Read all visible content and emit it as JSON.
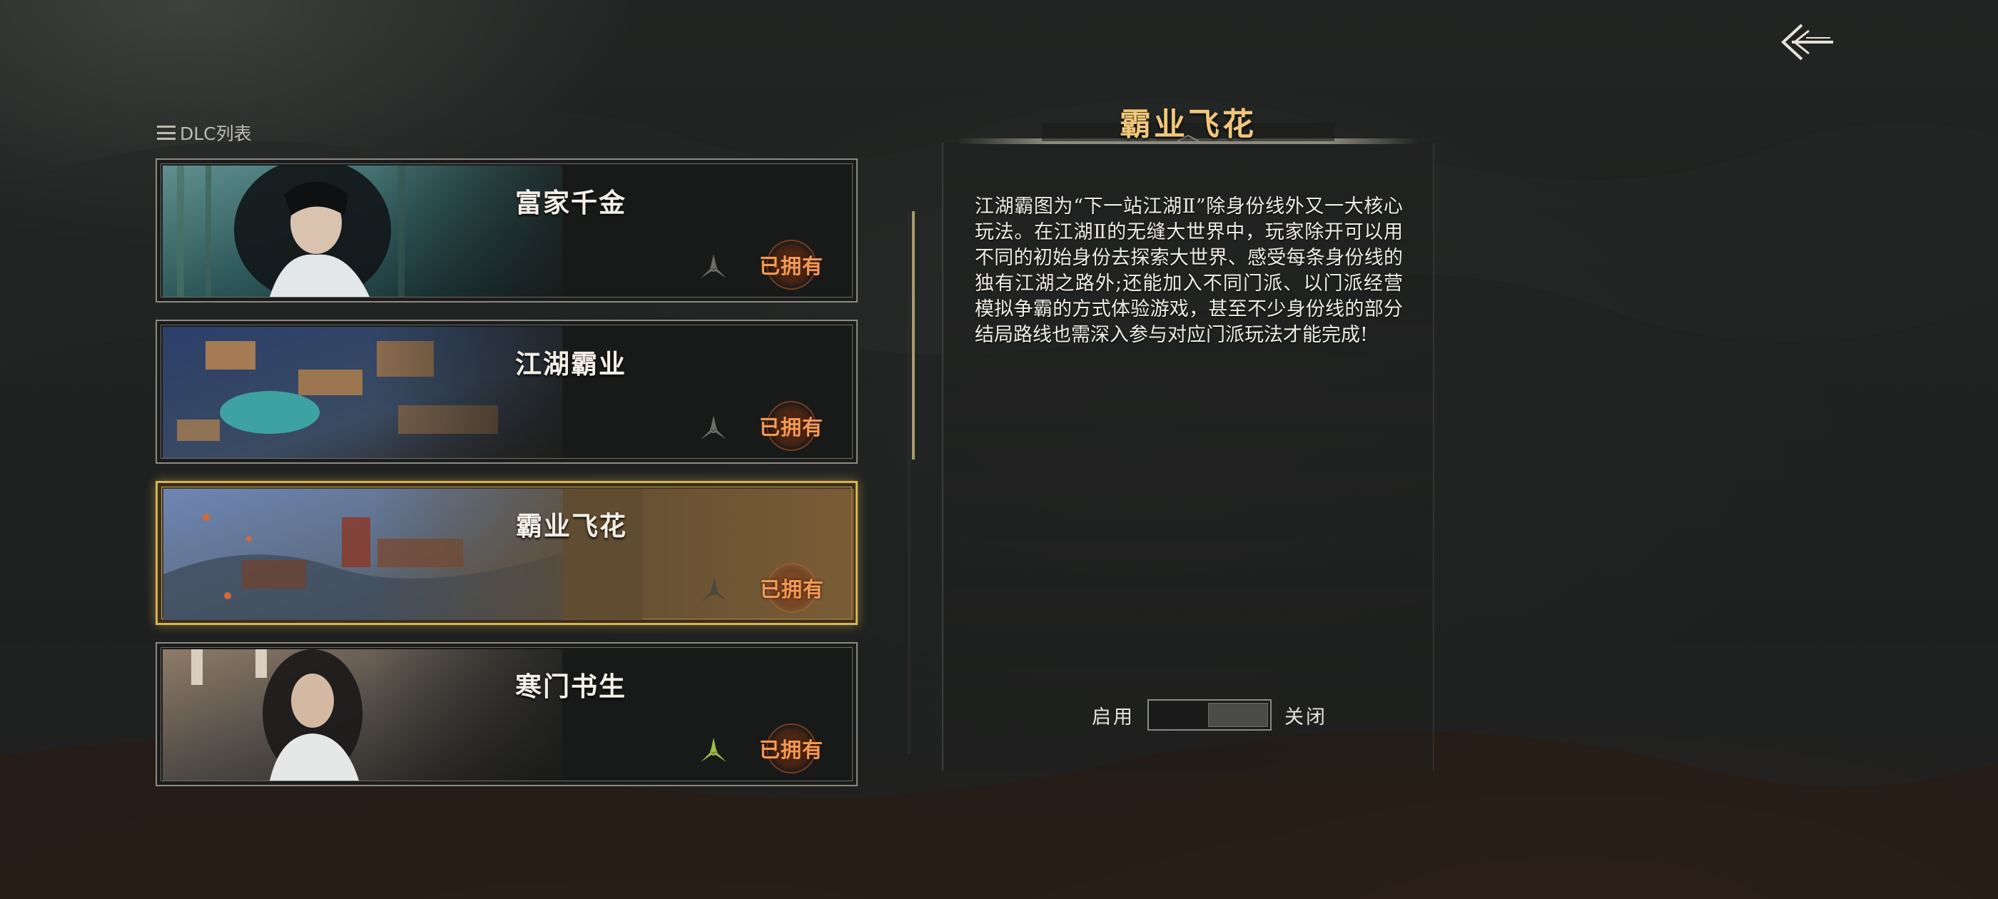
{
  "header": {
    "dlc_list_label": "DLC列表"
  },
  "dlc_cards": [
    {
      "title": "富家千金",
      "status": "已拥有",
      "selected": false,
      "icon": "triangle-emblem-icon"
    },
    {
      "title": "江湖霸业",
      "status": "已拥有",
      "selected": false,
      "icon": "triangle-emblem-icon"
    },
    {
      "title": "霸业飞花",
      "status": "已拥有",
      "selected": true,
      "icon": "triangle-emblem-icon"
    },
    {
      "title": "寒门书生",
      "status": "已拥有",
      "selected": false,
      "icon": "triangle-emblem-icon"
    }
  ],
  "detail": {
    "title": "霸业飞花",
    "description": "江湖霸图为“下一站江湖Ⅱ”除身份线外又一大核心玩法。在江湖Ⅱ的无缝大世界中，玩家除开可以用不同的初始身份去探索大世界、感受每条身份线的独有江湖之路外;还能加入不同门派、以门派经营模拟争霸的方式体验游戏，甚至不少身份线的部分结局路线也需深入参与对应门派玩法才能完成!",
    "toggle_on_label": "启用",
    "toggle_off_label": "关闭",
    "toggle_state": "off"
  },
  "colors": {
    "accent_gold": "#d9b253",
    "title_gold": "#f0c77a",
    "owned_orange": "#f19a53",
    "emblem_green": "#9bbf45"
  },
  "icons": {
    "back": "back-arrow-icon",
    "menu": "menu-icon"
  }
}
